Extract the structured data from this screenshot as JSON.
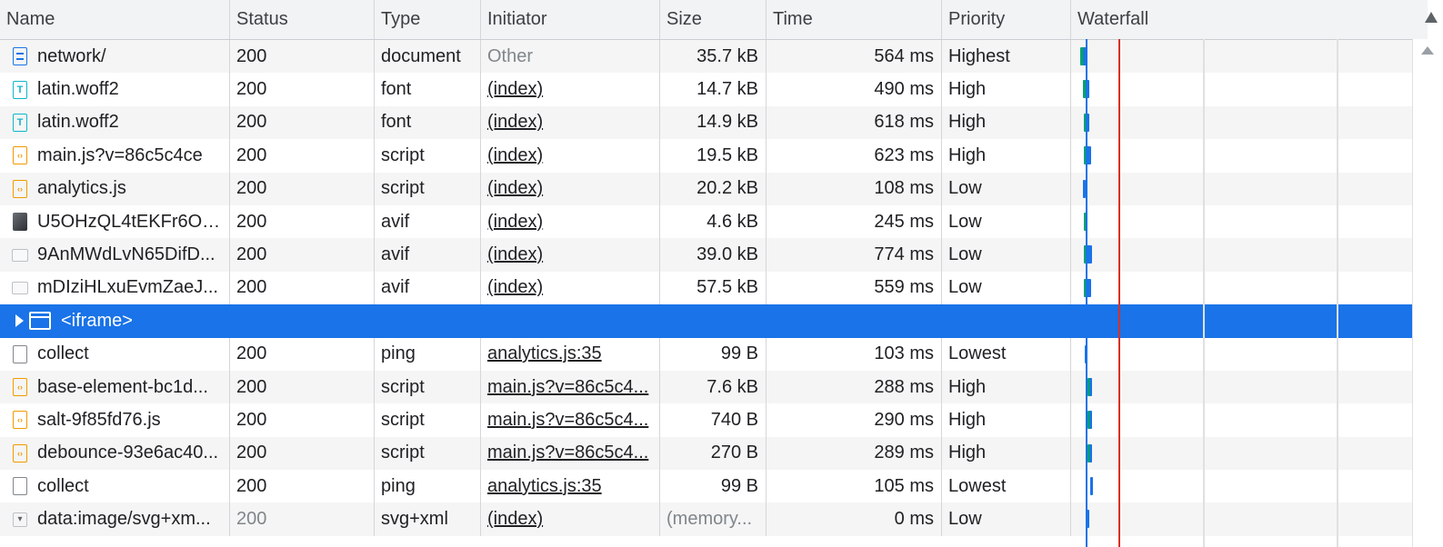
{
  "columns": {
    "name": "Name",
    "status": "Status",
    "type": "Type",
    "initiator": "Initiator",
    "size": "Size",
    "time": "Time",
    "priority": "Priority",
    "waterfall": "Waterfall"
  },
  "rows": [
    {
      "icon": "document-icon",
      "name": "network/",
      "status": "200",
      "type": "document",
      "initiator": "Other",
      "size": "35.7 kB",
      "time": "564 ms",
      "priority": "Highest"
    },
    {
      "icon": "font-icon",
      "name": "latin.woff2",
      "status": "200",
      "type": "font",
      "initiator": "(index)",
      "size": "14.7 kB",
      "time": "490 ms",
      "priority": "High"
    },
    {
      "icon": "font-icon",
      "name": "latin.woff2",
      "status": "200",
      "type": "font",
      "initiator": "(index)",
      "size": "14.9 kB",
      "time": "618 ms",
      "priority": "High"
    },
    {
      "icon": "script-icon",
      "name": "main.js?v=86c5c4ce",
      "status": "200",
      "type": "script",
      "initiator": "(index)",
      "size": "19.5 kB",
      "time": "623 ms",
      "priority": "High"
    },
    {
      "icon": "script-icon",
      "name": "analytics.js",
      "status": "200",
      "type": "script",
      "initiator": "(index)",
      "size": "20.2 kB",
      "time": "108 ms",
      "priority": "Low"
    },
    {
      "icon": "image-thumbnail-icon",
      "name": "U5OHzQL4tEKFr6OF...",
      "status": "200",
      "type": "avif",
      "initiator": "(index)",
      "size": "4.6 kB",
      "time": "245 ms",
      "priority": "Low"
    },
    {
      "icon": "image-thumbnail-icon",
      "name": "9AnMWdLvN65DifD...",
      "status": "200",
      "type": "avif",
      "initiator": "(index)",
      "size": "39.0 kB",
      "time": "774 ms",
      "priority": "Low"
    },
    {
      "icon": "image-thumbnail-icon",
      "name": "mDIziHLxuEvmZaeJ...",
      "status": "200",
      "type": "avif",
      "initiator": "(index)",
      "size": "57.5 kB",
      "time": "559 ms",
      "priority": "Low"
    },
    {
      "icon": "iframe-icon",
      "name": "<iframe>",
      "selected": true
    },
    {
      "icon": "ping-icon",
      "name": "collect",
      "status": "200",
      "type": "ping",
      "initiator": "analytics.js:35",
      "size": "99 B",
      "time": "103 ms",
      "priority": "Lowest"
    },
    {
      "icon": "script-icon",
      "name": "base-element-bc1d...",
      "status": "200",
      "type": "script",
      "initiator": "main.js?v=86c5c4...",
      "size": "7.6 kB",
      "time": "288 ms",
      "priority": "High"
    },
    {
      "icon": "script-icon",
      "name": "salt-9f85fd76.js",
      "status": "200",
      "type": "script",
      "initiator": "main.js?v=86c5c4...",
      "size": "740 B",
      "time": "290 ms",
      "priority": "High"
    },
    {
      "icon": "script-icon",
      "name": "debounce-93e6ac40...",
      "status": "200",
      "type": "script",
      "initiator": "main.js?v=86c5c4...",
      "size": "270 B",
      "time": "289 ms",
      "priority": "High"
    },
    {
      "icon": "ping-icon",
      "name": "collect",
      "status": "200",
      "type": "ping",
      "initiator": "analytics.js:35",
      "size": "99 B",
      "time": "105 ms",
      "priority": "Lowest"
    },
    {
      "icon": "svg-icon",
      "name": "data:image/svg+xm...",
      "status": "200",
      "type": "svg+xml",
      "initiator": "(index)",
      "size": "(memory...",
      "time": "0 ms",
      "priority": "Low"
    }
  ],
  "colors": {
    "selected_row": "#1a73e8",
    "dom_content_loaded_line": "#1a73e8",
    "load_line": "#d93025",
    "waiting_bar": "#00a36c",
    "download_bar": "#1a73e8"
  }
}
